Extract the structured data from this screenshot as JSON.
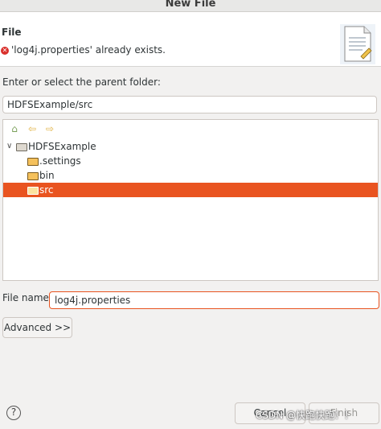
{
  "window": {
    "title": "New File"
  },
  "header": {
    "title": "File",
    "message": "'log4j.properties' already exists.",
    "icon": "document-icon"
  },
  "parent_folder": {
    "label": "Enter or select the parent folder:",
    "value": "HDFSExample/src"
  },
  "tree": {
    "nav": [
      "home-icon",
      "back-arrow-icon",
      "forward-arrow-icon"
    ],
    "items": [
      {
        "label": "HDFSExample",
        "expanded": true,
        "selected": false
      },
      {
        "label": ".settings",
        "selected": false
      },
      {
        "label": "bin",
        "selected": false
      },
      {
        "label": "src",
        "selected": true
      }
    ]
  },
  "file_name": {
    "label": "File name:",
    "value": "log4j.properties"
  },
  "buttons": {
    "advanced": "Advanced >>",
    "help": "?",
    "cancel": "Cancel",
    "finish": "Finish"
  },
  "watermark": "CSDN @快跑快跑！！",
  "colors": {
    "accent": "#e95420",
    "error": "#d9302c",
    "background": "#f2f1f0"
  }
}
